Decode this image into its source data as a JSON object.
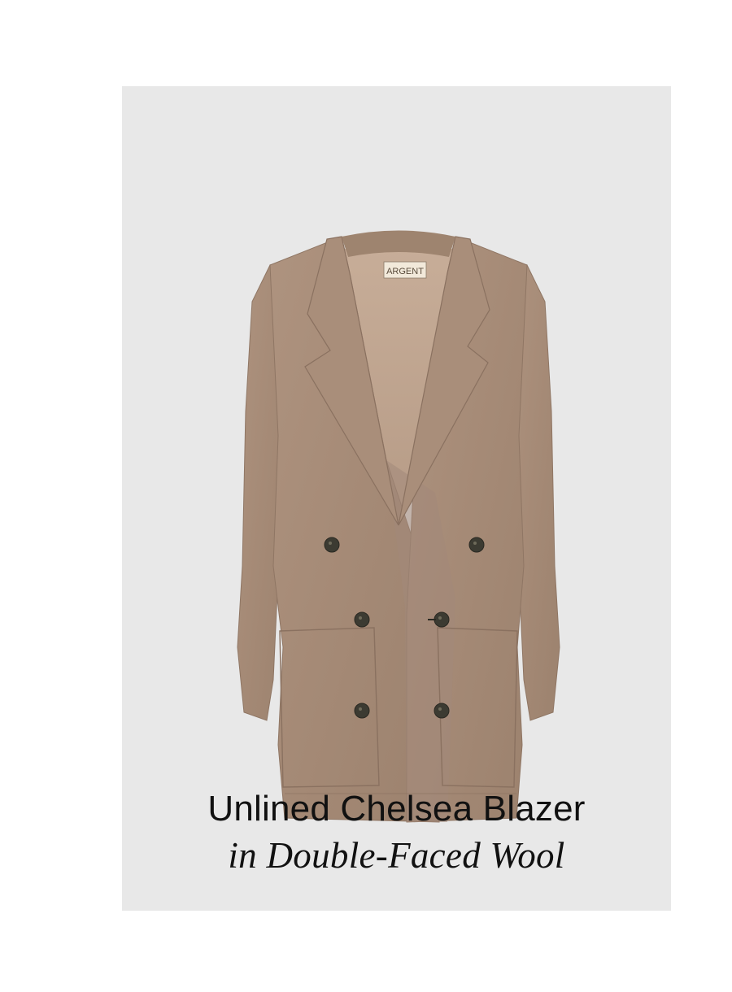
{
  "product": {
    "brand_label": "ARGENT",
    "title_line1": "Unlined Chelsea Blazer",
    "title_line2": "in Double-Faced Wool",
    "image_icon": "blazer-product-image"
  },
  "colors": {
    "card_background": "#e8e8e8",
    "fabric": "#a88c78",
    "fabric_dark": "#8c7462",
    "button": "#3c3b32",
    "text": "#111111"
  }
}
